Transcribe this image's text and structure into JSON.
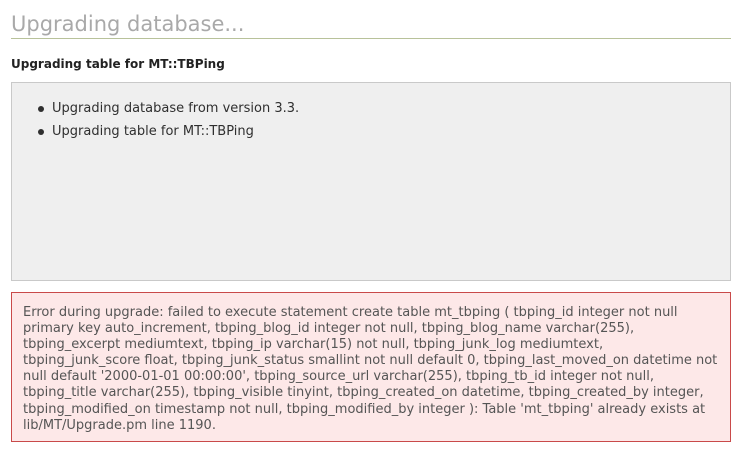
{
  "header": {
    "title": "Upgrading database...",
    "subtitle": "Upgrading table for MT::TBPing"
  },
  "log": {
    "items": [
      {
        "text": "Upgrading database from version 3.3."
      },
      {
        "text": "Upgrading table for MT::TBPing"
      }
    ]
  },
  "error": {
    "message": "Error during upgrade: failed to execute statement create table mt_tbping ( tbping_id integer not null primary key auto_increment, tbping_blog_id integer not null, tbping_blog_name varchar(255), tbping_excerpt mediumtext, tbping_ip varchar(15) not null, tbping_junk_log mediumtext, tbping_junk_score float, tbping_junk_status smallint not null default 0, tbping_last_moved_on datetime not null default '2000-01-01 00:00:00', tbping_source_url varchar(255), tbping_tb_id integer not null, tbping_title varchar(255), tbping_visible tinyint, tbping_created_on datetime, tbping_created_by integer, tbping_modified_on timestamp not null, tbping_modified_by integer ): Table 'mt_tbping' already exists at lib/MT/Upgrade.pm line 1190."
  },
  "colors": {
    "title": "#a9a9a9",
    "title_rule": "#b8c29a",
    "log_background": "#efefef",
    "error_background": "#fde8e8",
    "error_border": "#c94a4a"
  }
}
